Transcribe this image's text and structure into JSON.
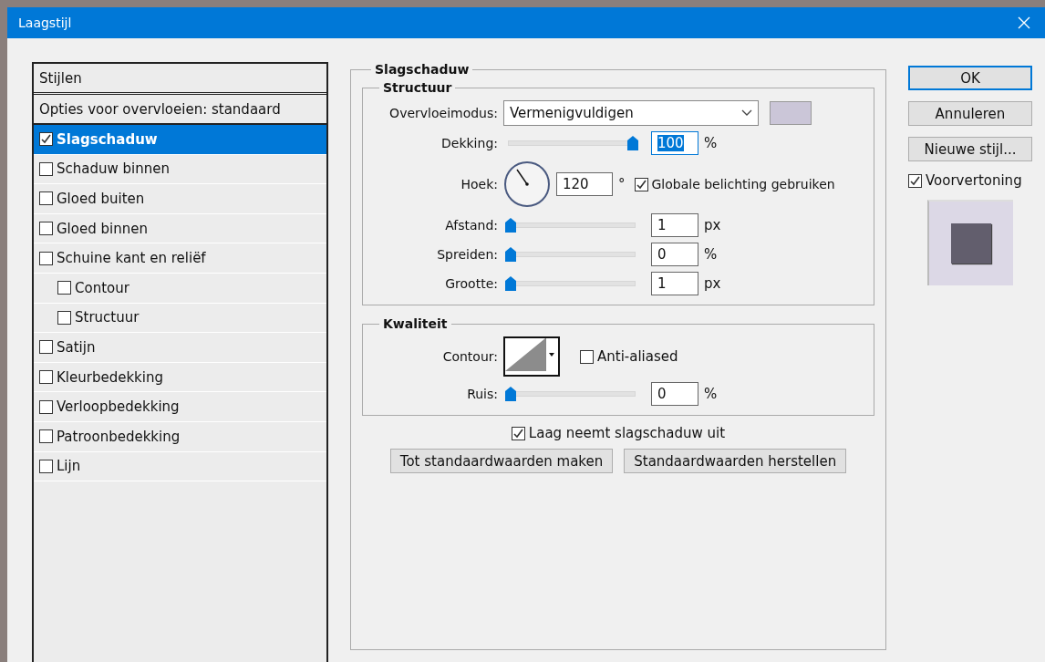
{
  "window": {
    "title": "Laagstijl"
  },
  "styles_panel": {
    "header": "Stijlen",
    "blend_options": "Opties voor overvloeien: standaard",
    "items": [
      {
        "label": "Slagschaduw",
        "checked": true,
        "selected": true
      },
      {
        "label": "Schaduw binnen",
        "checked": false,
        "selected": false
      },
      {
        "label": "Gloed buiten",
        "checked": false,
        "selected": false
      },
      {
        "label": "Gloed binnen",
        "checked": false,
        "selected": false
      },
      {
        "label": "Schuine kant en reliëf",
        "checked": false,
        "selected": false,
        "children": [
          {
            "label": "Contour",
            "checked": false,
            "selected": false
          },
          {
            "label": "Structuur",
            "checked": false,
            "selected": false
          }
        ]
      },
      {
        "label": "Satijn",
        "checked": false,
        "selected": false
      },
      {
        "label": "Kleurbedekking",
        "checked": false,
        "selected": false
      },
      {
        "label": "Verloopbedekking",
        "checked": false,
        "selected": false
      },
      {
        "label": "Patroonbedekking",
        "checked": false,
        "selected": false
      },
      {
        "label": "Lijn",
        "checked": false,
        "selected": false
      }
    ]
  },
  "settings": {
    "title": "Slagschaduw",
    "structure": {
      "title": "Structuur",
      "blend_mode_label": "Overvloeimodus:",
      "blend_mode": "Vermenigvuldigen",
      "opacity": {
        "label": "Dekking:",
        "level": 1,
        "value": "100",
        "unit": "%",
        "text_selected": true
      },
      "angle": {
        "label": "Hoek:",
        "value": "120",
        "unit": "°",
        "global_light": {
          "label": "Globale belichting gebruiken",
          "checked": true
        }
      },
      "sliders": [
        {
          "label": "Afstand:",
          "level": 0,
          "value": "1",
          "unit": "px"
        },
        {
          "label": "Spreiden:",
          "level": 0,
          "value": "0",
          "unit": "%"
        },
        {
          "label": "Grootte:",
          "level": 0,
          "value": "1",
          "unit": "px"
        }
      ]
    },
    "quality": {
      "title": "Kwaliteit",
      "contour_label": "Contour:",
      "anti_aliased": {
        "label": "Anti-aliased",
        "checked": false
      },
      "noise": {
        "label": "Ruis:",
        "level": 0,
        "value": "0",
        "unit": "%"
      }
    },
    "knockout": {
      "label": "Laag neemt slagschaduw uit",
      "checked": true
    },
    "buttons": [
      "Tot standaardwaarden maken",
      "Standaardwaarden herstellen"
    ]
  },
  "actions": {
    "buttons": [
      {
        "label": "OK",
        "default": true
      },
      {
        "label": "Annuleren",
        "default": false
      },
      {
        "label": "Nieuwe stijl...",
        "default": false
      }
    ],
    "preview": {
      "label": "Voorvertoning",
      "checked": true
    }
  }
}
